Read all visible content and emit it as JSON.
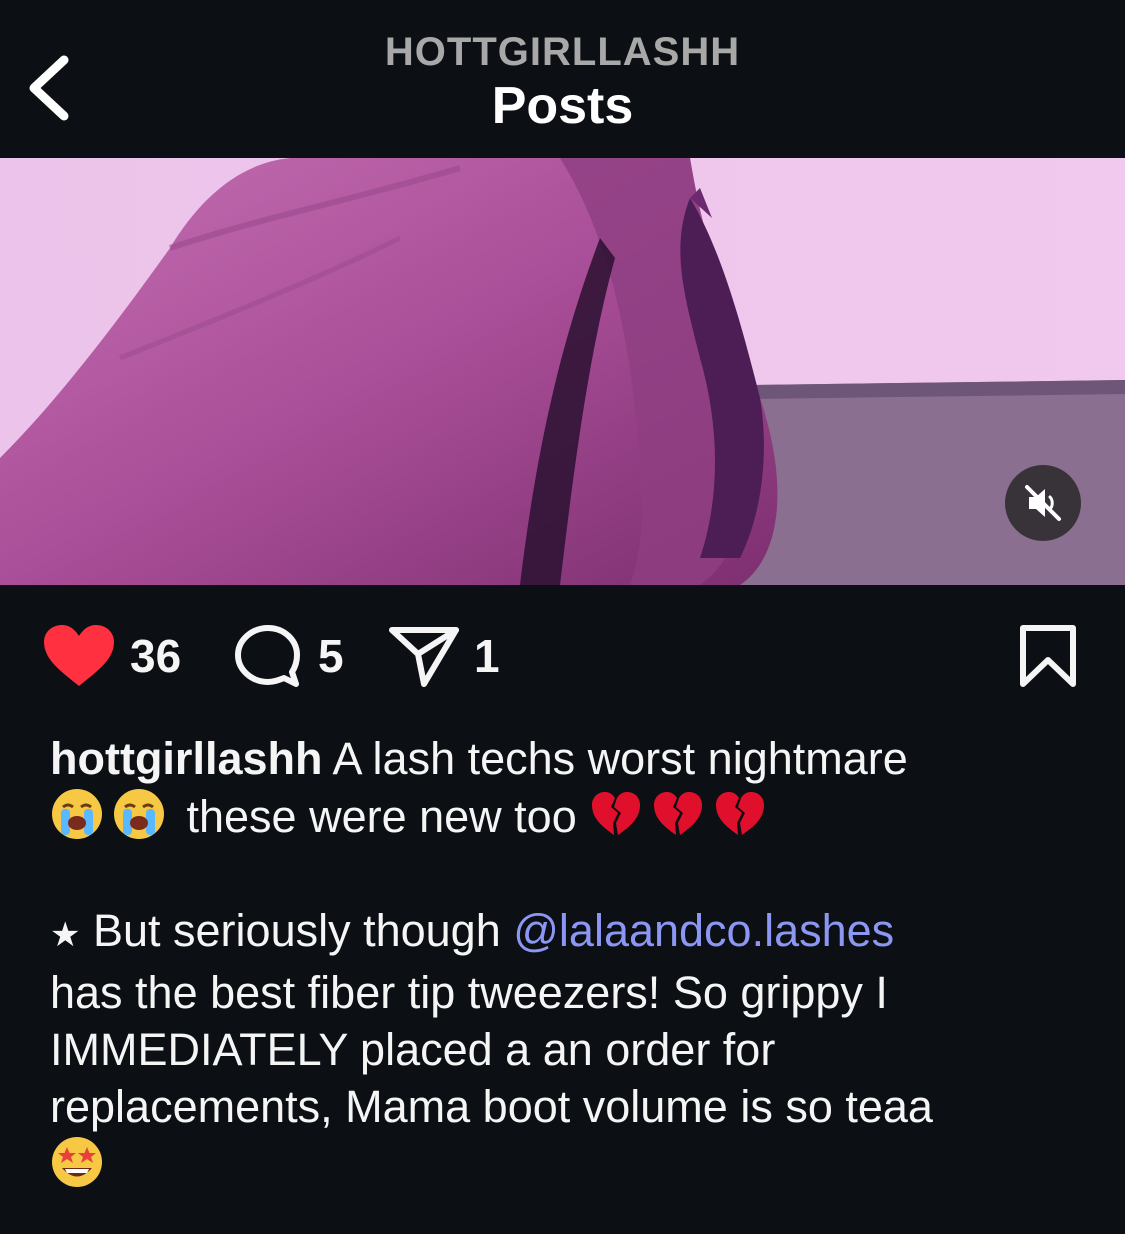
{
  "header": {
    "username": "HOTTGIRLLASHH",
    "title": "Posts",
    "back_icon": "chevron-left-icon"
  },
  "media": {
    "type": "video",
    "mute_icon": "speaker-muted-icon",
    "muted": true
  },
  "actions": {
    "likes": "36",
    "comments": "5",
    "shares": "1",
    "liked": true,
    "like_color": "#ff3040",
    "icons": [
      "heart-icon",
      "comment-icon",
      "share-icon",
      "bookmark-icon"
    ]
  },
  "caption": {
    "username": "hottgirllashh",
    "line1_text": " A lash techs worst nightmare",
    "line2_text": " these were new too ",
    "star": "★",
    "line3_prefix": " But seriously though ",
    "mention": "@lalaandco.lashes",
    "body": "has the best fiber tip tweezers! So grippy I IMMEDIATELY placed a an order for replacements, Mama boot volume is so teaa",
    "emojis": [
      "loudly-crying-face",
      "loudly-crying-face",
      "broken-heart",
      "broken-heart",
      "broken-heart",
      "star-struck"
    ]
  },
  "colors": {
    "background": "#0c1014",
    "mention": "#8c97f4",
    "muted_text": "#a8a8a8"
  }
}
